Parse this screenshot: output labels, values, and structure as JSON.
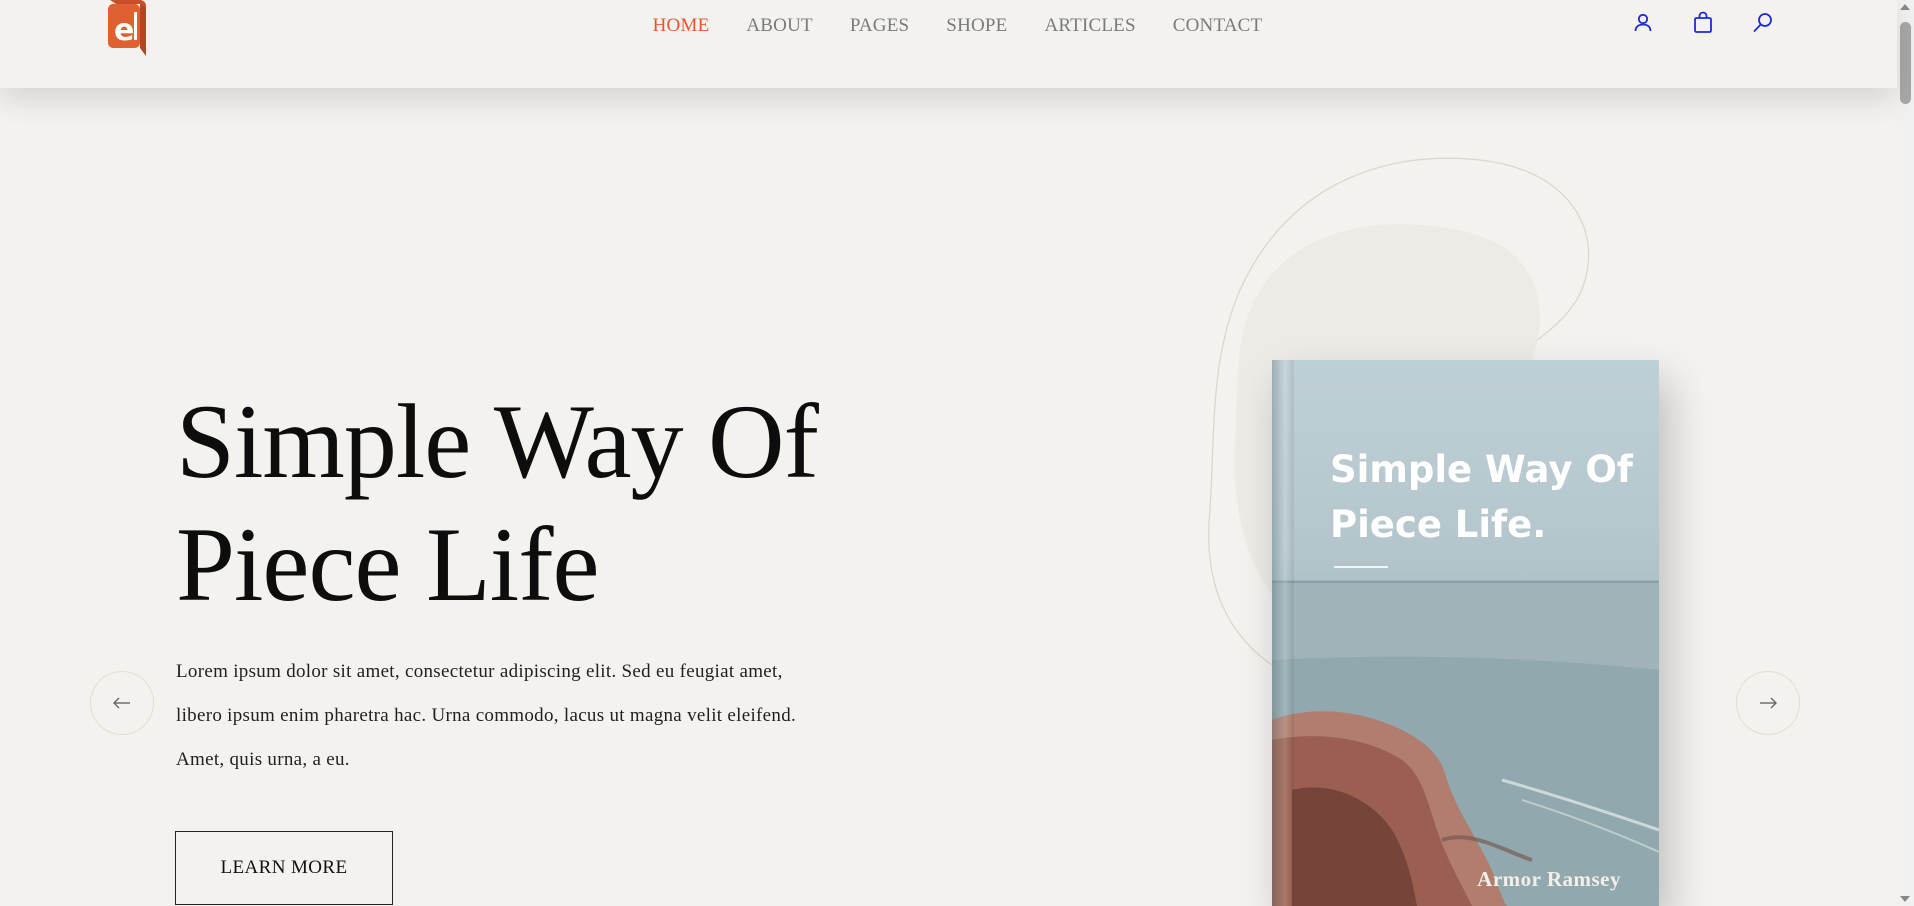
{
  "nav": {
    "items": [
      {
        "label": "HOME",
        "active": true
      },
      {
        "label": "ABOUT",
        "active": false
      },
      {
        "label": "PAGES",
        "active": false
      },
      {
        "label": "SHOPE",
        "active": false
      },
      {
        "label": "ARTICLES",
        "active": false
      },
      {
        "label": "CONTACT",
        "active": false
      }
    ]
  },
  "header_icons": [
    "user-icon",
    "shopping-bag-icon",
    "search-icon"
  ],
  "hero": {
    "title_line1": "Simple Way Of",
    "title_line2": "Piece Life",
    "description": "Lorem ipsum dolor sit amet, consectetur adipiscing elit. Sed eu feugiat amet, libero ipsum enim pharetra hac. Urna commodo, lacus ut magna velit eleifend. Amet, quis urna, a eu.",
    "button_label": "LEARN MORE"
  },
  "book": {
    "title_line1": "Simple Way Of",
    "title_line2": "Piece Life.",
    "author": "Armor Ramsey"
  },
  "colors": {
    "background": "#f3f2ee",
    "accent": "#e7552e",
    "icon": "#1a2bd6"
  }
}
